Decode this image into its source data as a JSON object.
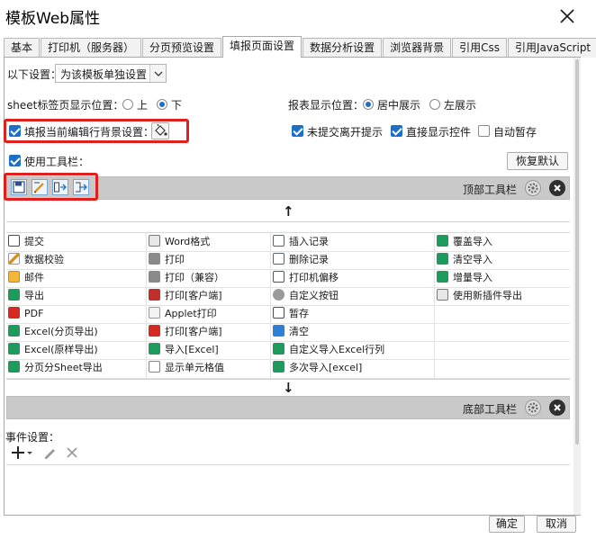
{
  "window": {
    "title": "模板Web属性"
  },
  "tabs": [
    {
      "label": "基本",
      "active": false
    },
    {
      "label": "打印机（服务器）",
      "active": false
    },
    {
      "label": "分页预览设置",
      "active": false
    },
    {
      "label": "填报页面设置",
      "active": true
    },
    {
      "label": "数据分析设置",
      "active": false
    },
    {
      "label": "浏览器背景",
      "active": false
    },
    {
      "label": "引用Css",
      "active": false
    },
    {
      "label": "引用JavaScript",
      "active": false
    }
  ],
  "settings": {
    "scope_label": "以下设置：",
    "scope_value": "为该模板单独设置",
    "sheet_pos_label": "sheet标签页显示位置：",
    "sheet_pos_options": [
      "上",
      "下"
    ],
    "sheet_pos_selected": "下",
    "report_pos_label": "报表显示位置：",
    "report_pos_options": [
      "居中展示",
      "左展示"
    ],
    "report_pos_selected": "居中展示",
    "fill_bg_label": "填报当前编辑行背景设置：",
    "fill_bg_checked": true,
    "unsubmitted_label": "未提交离开提示",
    "unsubmitted_checked": true,
    "direct_show_label": "直接显示控件",
    "direct_show_checked": true,
    "autosave_label": "自动暂存",
    "autosave_checked": false,
    "use_toolbar_label": "使用工具栏：",
    "use_toolbar_checked": true,
    "restore_default_label": "恢复默认"
  },
  "toolbar": {
    "top_label": "顶部工具栏",
    "bottom_label": "底部工具栏",
    "top_icons": [
      "save-icon",
      "verify-icon",
      "insert-row-icon",
      "delete-row-icon"
    ],
    "arrow_up": "↑",
    "arrow_down": "↓"
  },
  "buttons_grid": [
    [
      "提交",
      "Word格式",
      "插入记录",
      "覆盖导入"
    ],
    [
      "数据校验",
      "打印",
      "删除记录",
      "清空导入"
    ],
    [
      "邮件",
      "打印（兼容）",
      "打印机偏移",
      "增量导入"
    ],
    [
      "导出",
      "打印[客户端]",
      "自定义按钮",
      "使用新插件导出"
    ],
    [
      "PDF",
      "Applet打印",
      "暂存",
      ""
    ],
    [
      "Excel(分页导出)",
      "打印[客户端]",
      "清空",
      ""
    ],
    [
      "Excel(原样导出)",
      "导入[Excel]",
      "自定义导入Excel行列",
      ""
    ],
    [
      "分页分Sheet导出",
      "显示单元格值",
      "多次导入[excel]",
      ""
    ]
  ],
  "events": {
    "label": "事件设置：",
    "add_icon": "plus-icon",
    "edit_icon": "pencil-icon",
    "delete_icon": "x-icon"
  },
  "footer": {
    "ok_label": "确定",
    "cancel_label": "取消"
  },
  "colors": {
    "accent": "#1f6fc5",
    "highlight": "#e0201c",
    "toolbar_bg": "#c9c9c9"
  }
}
